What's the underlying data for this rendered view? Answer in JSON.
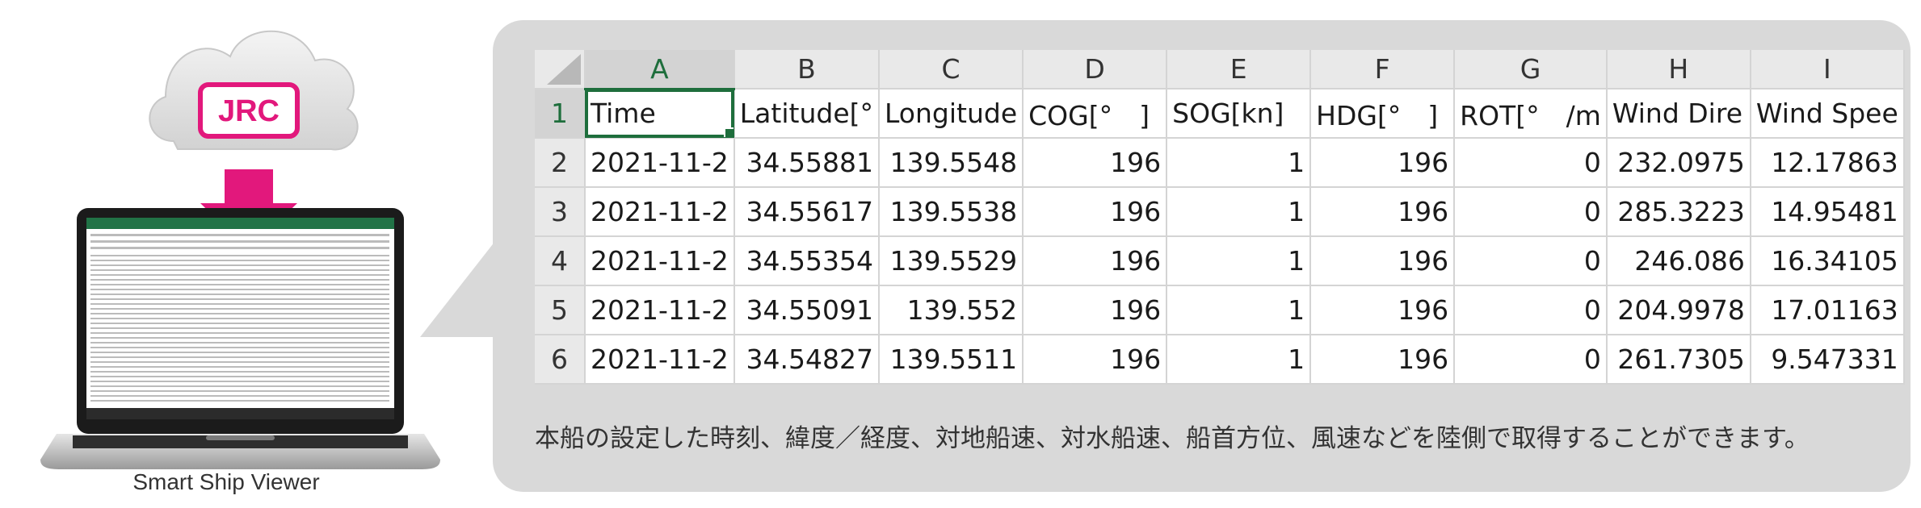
{
  "illustration": {
    "cloud_logo_text": "JRC",
    "brand_color": "#e2187c",
    "caption": "Smart Ship Viewer"
  },
  "sheet": {
    "columns": [
      "A",
      "B",
      "C",
      "D",
      "E",
      "F",
      "G",
      "H",
      "I"
    ],
    "rows": [
      {
        "num": "1",
        "cells": [
          "Time",
          "Latitude[°",
          "Longitude",
          "COG[°　]",
          "SOG[kn]",
          "HDG[°　]",
          "ROT[°　/m",
          "Wind Dire",
          "Wind Spee"
        ]
      },
      {
        "num": "2",
        "cells": [
          "2021-11-2",
          "34.55881",
          "139.5548",
          "196",
          "1",
          "196",
          "0",
          "232.0975",
          "12.17863"
        ]
      },
      {
        "num": "3",
        "cells": [
          "2021-11-2",
          "34.55617",
          "139.5538",
          "196",
          "1",
          "196",
          "0",
          "285.3223",
          "14.95481"
        ]
      },
      {
        "num": "4",
        "cells": [
          "2021-11-2",
          "34.55354",
          "139.5529",
          "196",
          "1",
          "196",
          "0",
          "246.086",
          "16.34105"
        ]
      },
      {
        "num": "5",
        "cells": [
          "2021-11-2",
          "34.55091",
          "139.552",
          "196",
          "1",
          "196",
          "0",
          "204.9978",
          "17.01163"
        ]
      },
      {
        "num": "6",
        "cells": [
          "2021-11-2",
          "34.54827",
          "139.5511",
          "196",
          "1",
          "196",
          "0",
          "261.7305",
          "9.547331"
        ]
      }
    ],
    "selected_cell": "A1",
    "accent_color": "#1e6e3c"
  },
  "note": "本船の設定した時刻、緯度／経度、対地船速、対水船速、船首方位、風速などを陸側で取得することができます。"
}
